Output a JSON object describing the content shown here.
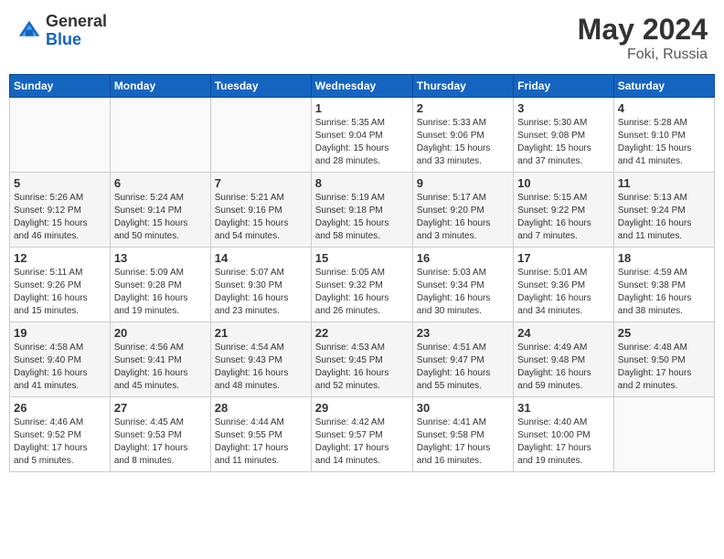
{
  "header": {
    "logo_general": "General",
    "logo_blue": "Blue",
    "month_year": "May 2024",
    "location": "Foki, Russia"
  },
  "weekdays": [
    "Sunday",
    "Monday",
    "Tuesday",
    "Wednesday",
    "Thursday",
    "Friday",
    "Saturday"
  ],
  "weeks": [
    [
      {
        "day": "",
        "info": ""
      },
      {
        "day": "",
        "info": ""
      },
      {
        "day": "",
        "info": ""
      },
      {
        "day": "1",
        "info": "Sunrise: 5:35 AM\nSunset: 9:04 PM\nDaylight: 15 hours\nand 28 minutes."
      },
      {
        "day": "2",
        "info": "Sunrise: 5:33 AM\nSunset: 9:06 PM\nDaylight: 15 hours\nand 33 minutes."
      },
      {
        "day": "3",
        "info": "Sunrise: 5:30 AM\nSunset: 9:08 PM\nDaylight: 15 hours\nand 37 minutes."
      },
      {
        "day": "4",
        "info": "Sunrise: 5:28 AM\nSunset: 9:10 PM\nDaylight: 15 hours\nand 41 minutes."
      }
    ],
    [
      {
        "day": "5",
        "info": "Sunrise: 5:26 AM\nSunset: 9:12 PM\nDaylight: 15 hours\nand 46 minutes."
      },
      {
        "day": "6",
        "info": "Sunrise: 5:24 AM\nSunset: 9:14 PM\nDaylight: 15 hours\nand 50 minutes."
      },
      {
        "day": "7",
        "info": "Sunrise: 5:21 AM\nSunset: 9:16 PM\nDaylight: 15 hours\nand 54 minutes."
      },
      {
        "day": "8",
        "info": "Sunrise: 5:19 AM\nSunset: 9:18 PM\nDaylight: 15 hours\nand 58 minutes."
      },
      {
        "day": "9",
        "info": "Sunrise: 5:17 AM\nSunset: 9:20 PM\nDaylight: 16 hours\nand 3 minutes."
      },
      {
        "day": "10",
        "info": "Sunrise: 5:15 AM\nSunset: 9:22 PM\nDaylight: 16 hours\nand 7 minutes."
      },
      {
        "day": "11",
        "info": "Sunrise: 5:13 AM\nSunset: 9:24 PM\nDaylight: 16 hours\nand 11 minutes."
      }
    ],
    [
      {
        "day": "12",
        "info": "Sunrise: 5:11 AM\nSunset: 9:26 PM\nDaylight: 16 hours\nand 15 minutes."
      },
      {
        "day": "13",
        "info": "Sunrise: 5:09 AM\nSunset: 9:28 PM\nDaylight: 16 hours\nand 19 minutes."
      },
      {
        "day": "14",
        "info": "Sunrise: 5:07 AM\nSunset: 9:30 PM\nDaylight: 16 hours\nand 23 minutes."
      },
      {
        "day": "15",
        "info": "Sunrise: 5:05 AM\nSunset: 9:32 PM\nDaylight: 16 hours\nand 26 minutes."
      },
      {
        "day": "16",
        "info": "Sunrise: 5:03 AM\nSunset: 9:34 PM\nDaylight: 16 hours\nand 30 minutes."
      },
      {
        "day": "17",
        "info": "Sunrise: 5:01 AM\nSunset: 9:36 PM\nDaylight: 16 hours\nand 34 minutes."
      },
      {
        "day": "18",
        "info": "Sunrise: 4:59 AM\nSunset: 9:38 PM\nDaylight: 16 hours\nand 38 minutes."
      }
    ],
    [
      {
        "day": "19",
        "info": "Sunrise: 4:58 AM\nSunset: 9:40 PM\nDaylight: 16 hours\nand 41 minutes."
      },
      {
        "day": "20",
        "info": "Sunrise: 4:56 AM\nSunset: 9:41 PM\nDaylight: 16 hours\nand 45 minutes."
      },
      {
        "day": "21",
        "info": "Sunrise: 4:54 AM\nSunset: 9:43 PM\nDaylight: 16 hours\nand 48 minutes."
      },
      {
        "day": "22",
        "info": "Sunrise: 4:53 AM\nSunset: 9:45 PM\nDaylight: 16 hours\nand 52 minutes."
      },
      {
        "day": "23",
        "info": "Sunrise: 4:51 AM\nSunset: 9:47 PM\nDaylight: 16 hours\nand 55 minutes."
      },
      {
        "day": "24",
        "info": "Sunrise: 4:49 AM\nSunset: 9:48 PM\nDaylight: 16 hours\nand 59 minutes."
      },
      {
        "day": "25",
        "info": "Sunrise: 4:48 AM\nSunset: 9:50 PM\nDaylight: 17 hours\nand 2 minutes."
      }
    ],
    [
      {
        "day": "26",
        "info": "Sunrise: 4:46 AM\nSunset: 9:52 PM\nDaylight: 17 hours\nand 5 minutes."
      },
      {
        "day": "27",
        "info": "Sunrise: 4:45 AM\nSunset: 9:53 PM\nDaylight: 17 hours\nand 8 minutes."
      },
      {
        "day": "28",
        "info": "Sunrise: 4:44 AM\nSunset: 9:55 PM\nDaylight: 17 hours\nand 11 minutes."
      },
      {
        "day": "29",
        "info": "Sunrise: 4:42 AM\nSunset: 9:57 PM\nDaylight: 17 hours\nand 14 minutes."
      },
      {
        "day": "30",
        "info": "Sunrise: 4:41 AM\nSunset: 9:58 PM\nDaylight: 17 hours\nand 16 minutes."
      },
      {
        "day": "31",
        "info": "Sunrise: 4:40 AM\nSunset: 10:00 PM\nDaylight: 17 hours\nand 19 minutes."
      },
      {
        "day": "",
        "info": ""
      }
    ]
  ]
}
